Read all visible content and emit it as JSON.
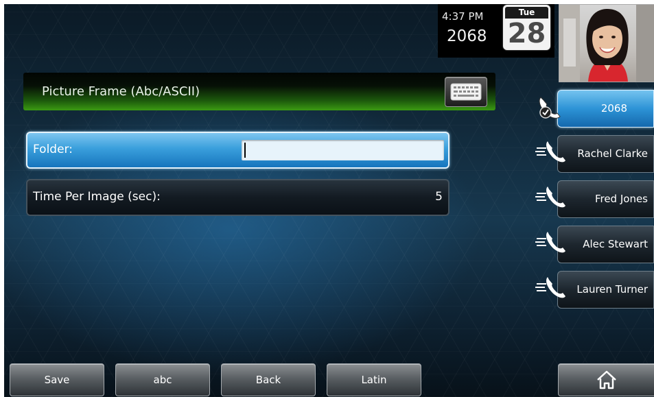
{
  "status": {
    "time": "4:37 PM",
    "extension": "2068",
    "calendar": {
      "day_of_week": "Tue",
      "day": "28"
    }
  },
  "title": {
    "text": "Picture Frame (Abc/ASCII)",
    "keyboard_icon": "keyboard-icon"
  },
  "fields": [
    {
      "label": "Folder:",
      "value": "",
      "focused": true
    },
    {
      "label": "Time Per Image (sec):",
      "value": "5"
    }
  ],
  "line_keys": [
    {
      "label": "2068",
      "icon": "line-registered-icon",
      "active": true
    },
    {
      "label": "Rachel Clarke",
      "icon": "phone-speed-dial-icon"
    },
    {
      "label": "Fred Jones",
      "icon": "phone-speed-dial-icon"
    },
    {
      "label": "Alec Stewart",
      "icon": "phone-speed-dial-icon"
    },
    {
      "label": "Lauren Turner",
      "icon": "phone-speed-dial-icon"
    }
  ],
  "softkeys": [
    "Save",
    "abc",
    "Back",
    "Latin"
  ],
  "home": {
    "icon": "home-icon"
  },
  "colors": {
    "accent_blue": "#2d93d6",
    "title_green": "#3b9a12"
  }
}
